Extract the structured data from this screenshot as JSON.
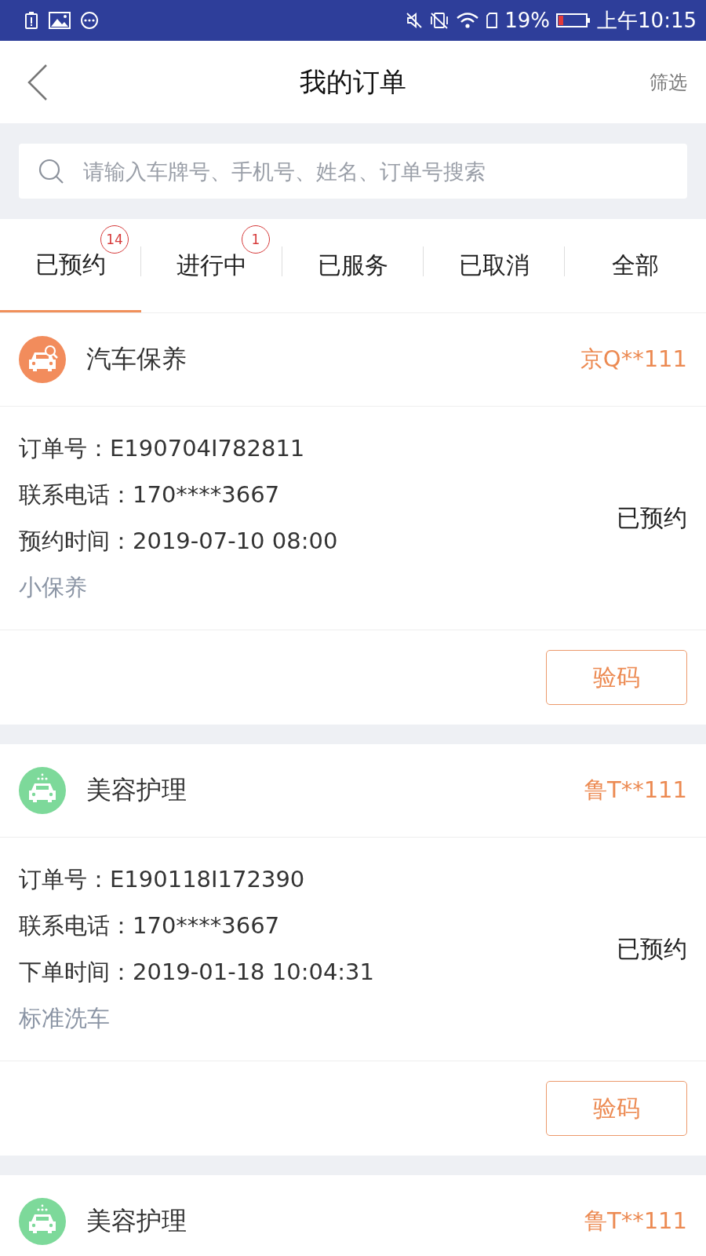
{
  "status_bar": {
    "battery_text": "19%",
    "time": "上午10:15"
  },
  "header": {
    "title": "我的订单",
    "action": "筛选"
  },
  "search": {
    "placeholder": "请输入车牌号、手机号、姓名、订单号搜索"
  },
  "tabs": [
    {
      "label": "已预约",
      "selected": true,
      "badge": "14"
    },
    {
      "label": "进行中",
      "selected": false,
      "badge": "1"
    },
    {
      "label": "已服务",
      "selected": false
    },
    {
      "label": "已取消",
      "selected": false
    },
    {
      "label": "全部",
      "selected": false
    }
  ],
  "orders": [
    {
      "kind": "maintenance",
      "color": "#f28c5c",
      "service": "汽车保养",
      "plate": "京Q**111",
      "rows": [
        {
          "label": "订单号：",
          "value": "E190704I782811"
        },
        {
          "label": "联系电话：",
          "value": "170****3667"
        },
        {
          "label": "预约时间：",
          "value": "2019-07-10 08:00"
        }
      ],
      "item": "小保养",
      "status": "已预约",
      "button": "验码"
    },
    {
      "kind": "wash",
      "color": "#7dd99a",
      "service": "美容护理",
      "plate": "鲁T**111",
      "rows": [
        {
          "label": "订单号：",
          "value": "E190118I172390"
        },
        {
          "label": "联系电话：",
          "value": "170****3667"
        },
        {
          "label": "下单时间：",
          "value": "2019-01-18 10:04:31"
        }
      ],
      "item": "标准洗车",
      "status": "已预约",
      "button": "验码"
    },
    {
      "kind": "wash",
      "color": "#7dd99a",
      "service": "美容护理",
      "plate": "鲁T**111"
    }
  ]
}
